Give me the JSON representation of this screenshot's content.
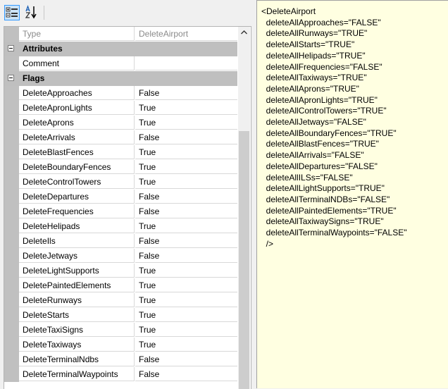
{
  "toolbar": {
    "buttons": [
      {
        "name": "categorized-view",
        "icon": "categorized-icon",
        "active": true
      },
      {
        "name": "alphabetical-sort",
        "icon": "sort-az-icon",
        "active": false
      }
    ]
  },
  "grid": {
    "header": {
      "name": "Type",
      "value": "DeleteAirport"
    },
    "categories": [
      {
        "title": "Attributes",
        "properties": [
          {
            "name": "Comment",
            "value": ""
          }
        ]
      },
      {
        "title": "Flags",
        "properties": [
          {
            "name": "DeleteApproaches",
            "value": "False"
          },
          {
            "name": "DeleteApronLights",
            "value": "True"
          },
          {
            "name": "DeleteAprons",
            "value": "True"
          },
          {
            "name": "DeleteArrivals",
            "value": "False"
          },
          {
            "name": "DeleteBlastFences",
            "value": "True"
          },
          {
            "name": "DeleteBoundaryFences",
            "value": "True"
          },
          {
            "name": "DeleteControlTowers",
            "value": "True"
          },
          {
            "name": "DeleteDepartures",
            "value": "False"
          },
          {
            "name": "DeleteFrequencies",
            "value": "False"
          },
          {
            "name": "DeleteHelipads",
            "value": "True"
          },
          {
            "name": "DeleteIls",
            "value": "False"
          },
          {
            "name": "DeleteJetways",
            "value": "False"
          },
          {
            "name": "DeleteLightSupports",
            "value": "True"
          },
          {
            "name": "DeletePaintedElements",
            "value": "True"
          },
          {
            "name": "DeleteRunways",
            "value": "True"
          },
          {
            "name": "DeleteStarts",
            "value": "True"
          },
          {
            "name": "DeleteTaxiSigns",
            "value": "True"
          },
          {
            "name": "DeleteTaxiways",
            "value": "True"
          },
          {
            "name": "DeleteTerminalNdbs",
            "value": "False"
          },
          {
            "name": "DeleteTerminalWaypoints",
            "value": "False"
          }
        ]
      }
    ]
  },
  "xml_preview": {
    "lines": [
      "<DeleteAirport",
      "  deleteAllApproaches=\"FALSE\"",
      "  deleteAllRunways=\"TRUE\"",
      "  deleteAllStarts=\"TRUE\"",
      "  deleteAllHelipads=\"TRUE\"",
      "  deleteAllFrequencies=\"FALSE\"",
      "  deleteAllTaxiways=\"TRUE\"",
      "  deleteAllAprons=\"TRUE\"",
      "  deleteAllApronLights=\"TRUE\"",
      "  deleteAllControlTowers=\"TRUE\"",
      "  deleteAllJetways=\"FALSE\"",
      "  deleteAllBoundaryFences=\"TRUE\"",
      "  deleteAllBlastFences=\"TRUE\"",
      "  deleteAllArrivals=\"FALSE\"",
      "  deleteAllDepartures=\"FALSE\"",
      "  deleteAllILSs=\"FALSE\"",
      "  deleteAllLightSupports=\"TRUE\"",
      "  deleteAllTerminalNDBs=\"FALSE\"",
      "  deleteAllPaintedElements=\"TRUE\"",
      "  deleteAllTaxiwaySigns=\"TRUE\"",
      "  deleteAllTerminalWaypoints=\"FALSE\"",
      "  />"
    ]
  },
  "colors": {
    "category_band": "#bfbfbf",
    "xml_background": "#ffffe1",
    "toolbar_active_border": "#3399ff",
    "toolbar_active_fill": "#cce4f7"
  }
}
